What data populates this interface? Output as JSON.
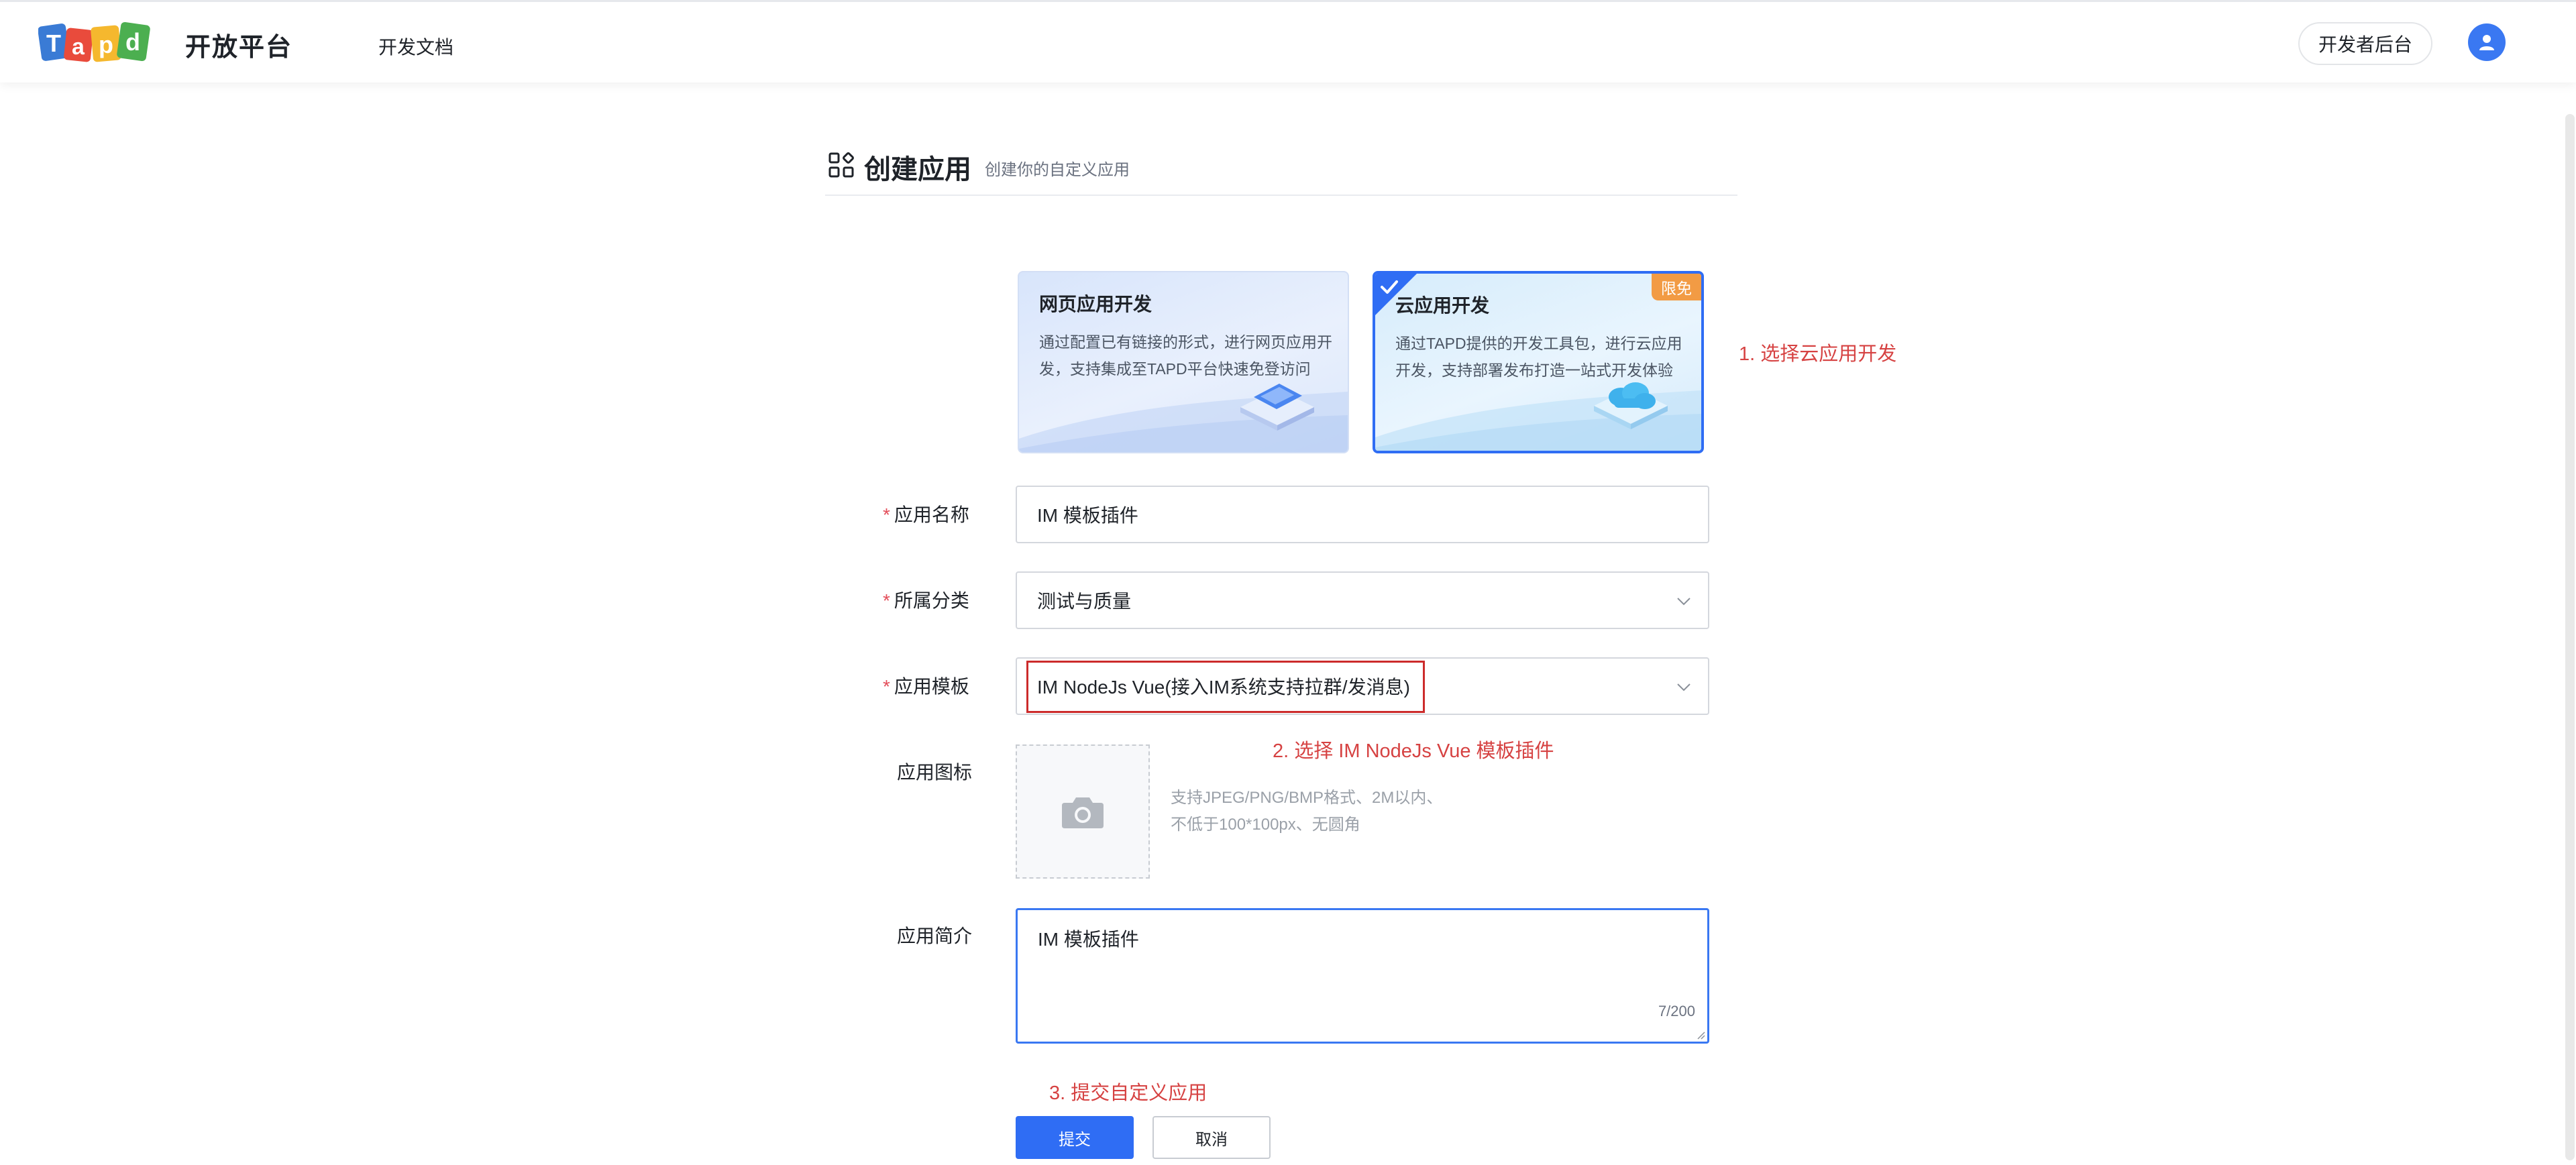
{
  "header": {
    "logo_text": "Tapd",
    "platform_title": "开放平台",
    "nav_docs": "开发文档",
    "dev_console_button": "开发者后台"
  },
  "page": {
    "title": "创建应用",
    "subtitle": "创建你的自定义应用"
  },
  "cards": {
    "web": {
      "title": "网页应用开发",
      "description": "通过配置已有链接的形式，进行网页应用开发，支持集成至TAPD平台快速免登访问"
    },
    "cloud": {
      "title": "云应用开发",
      "description": "通过TAPD提供的开发工具包，进行云应用开发，支持部署发布打造一站式开发体验",
      "badge": "限免",
      "selected": true
    }
  },
  "annotations": {
    "step1": "1. 选择云应用开发",
    "step2": "2. 选择 IM NodeJs Vue 模板插件",
    "step3": "3. 提交自定义应用"
  },
  "form": {
    "required_mark": "*",
    "app_name": {
      "label": "应用名称",
      "value": "IM 模板插件"
    },
    "category": {
      "label": "所属分类",
      "value": "测试与质量"
    },
    "template": {
      "label": "应用模板",
      "value": "IM NodeJs Vue(接入IM系统支持拉群/发消息)"
    },
    "icon": {
      "label": "应用图标",
      "hint_line1": "支持JPEG/PNG/BMP格式、2M以内、",
      "hint_line2": "不低于100*100px、无圆角"
    },
    "description": {
      "label": "应用简介",
      "value": "IM 模板插件",
      "char_count": "7/200"
    }
  },
  "buttons": {
    "submit": "提交",
    "cancel": "取消"
  },
  "colors": {
    "primary": "#2f6df4",
    "annotation_red": "#d64242",
    "badge_orange": "#f29b44",
    "required_red": "#e34d59"
  }
}
